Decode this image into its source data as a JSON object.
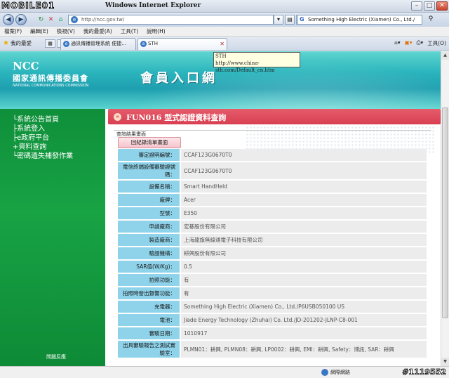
{
  "browser": {
    "watermark_logo": "MOBILE01",
    "window_title": "Windows Internet Explorer",
    "address": "http://ncc.gov.tw/",
    "search_text": "Something High Electric (Xiamen) Co., Ltd./",
    "menu": [
      "檔案(F)",
      "編輯(E)",
      "檢視(V)",
      "我的最愛(A)",
      "工具(T)",
      "說明(H)"
    ],
    "favorites_label": "我的最愛",
    "tabs": [
      {
        "label": "通訊傳播管理系統 便捷..."
      },
      {
        "label": "STH"
      }
    ],
    "tools_label": "工具(O)",
    "tooltip_line1": "STH",
    "tooltip_line2": "http://www.china-sth.com/Default_cn.htm",
    "status_network": "網際網路",
    "status_watermark": "#1119552"
  },
  "banner": {
    "ncc": "NCC",
    "org_cn": "國家通訊傳播委員會",
    "org_en": "NATIONAL COMMUNICATIONS COMMISSION",
    "portal": "會員入口網"
  },
  "sidebar": {
    "items": [
      "系統公告首頁",
      "系統登入",
      "e政府平台",
      "資料查詢",
      "密碼遺失補發作業"
    ],
    "footer": "問題反應"
  },
  "main": {
    "page_title": "FUN016 型式認證資料查詢",
    "result_label": "查詢結果畫面",
    "back_button": "回紀錄清單畫面",
    "rows": [
      {
        "k": "審定證明編號：",
        "v": "CCAF123G0670T0"
      },
      {
        "k": "電信終端設備審驗證號碼：",
        "v": "CCAF123G0670T0"
      },
      {
        "k": "設備名稱：",
        "v": "Smart HandHeld"
      },
      {
        "k": "廠牌：",
        "v": "Acer"
      },
      {
        "k": "型號：",
        "v": "E350"
      },
      {
        "k": "申請廠商：",
        "v": "宏碁股份有限公司"
      },
      {
        "k": "製造廠商：",
        "v": "上海龍旗無線通電子科技有限公司"
      },
      {
        "k": "驗證機構：",
        "v": "耕興股份有限公司"
      },
      {
        "k": "SAR值(W/Kg)：",
        "v": "0.5"
      },
      {
        "k": "拍照功能：",
        "v": "有"
      },
      {
        "k": "拍照時發出聲響功能：",
        "v": "有"
      },
      {
        "k": "充電器：",
        "v": "Something High Electric (Xiamen) Co., Ltd./P6USB050100 US"
      },
      {
        "k": "電池：",
        "v": "Jiade Energy Technology (Zhuhai) Co. Ltd./JD-201202-JLNP-C8-001"
      },
      {
        "k": "審驗日期：",
        "v": "1010917"
      },
      {
        "k": "出具審驗報告之測試實驗室：",
        "v": "PLMN01：耕興, PLMN08：耕興, LP0002：耕興, EMI：耕興, Safety：博訊, SAR：耕興"
      }
    ]
  }
}
